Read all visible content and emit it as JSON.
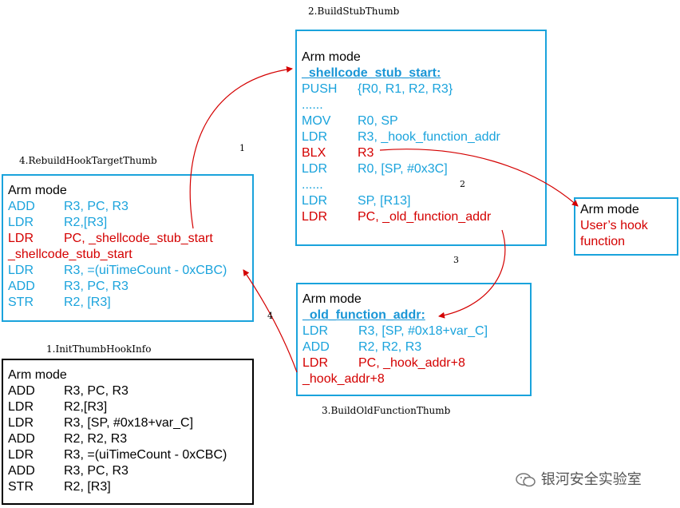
{
  "captions": {
    "build_stub": "2.BuildStubThumb",
    "rebuild_hook": "4.RebuildHookTargetThumb",
    "init_hook": "1.InitThumbHookInfo",
    "build_old": "3.BuildOldFunctionThumb"
  },
  "arrow_labels": [
    "1",
    "2",
    "3",
    "4"
  ],
  "stub_box": {
    "mode": "Arm mode",
    "label": "_shellcode_stub_start:",
    "lines": [
      {
        "op": "PUSH",
        "arg": "{R0, R1, R2, R3}",
        "color": "blue"
      },
      {
        "op": "......",
        "arg": "",
        "color": "blue"
      },
      {
        "op": "MOV",
        "arg": "R0, SP",
        "color": "blue"
      },
      {
        "op": "LDR",
        "arg": "R3, _hook_function_addr",
        "color": "blue"
      },
      {
        "op": "BLX",
        "arg": "R3",
        "color": "red"
      },
      {
        "op": "LDR",
        "arg": "R0, [SP, #0x3C]",
        "color": "blue"
      },
      {
        "op": "......",
        "arg": "",
        "color": "blue"
      },
      {
        "op": "LDR",
        "arg": "SP, [R13]",
        "color": "blue"
      },
      {
        "op": "LDR",
        "arg": "PC, _old_function_addr",
        "color": "red"
      }
    ]
  },
  "rebuild_box": {
    "mode": "Arm mode",
    "lines": [
      {
        "op": "ADD",
        "arg": "R3, PC, R3",
        "color": "blue"
      },
      {
        "op": "LDR",
        "arg": "R2,[R3]",
        "color": "blue"
      },
      {
        "op": "LDR",
        "arg": "PC, _shellcode_stub_start",
        "color": "red"
      },
      {
        "op": "_shellcode_stub_start",
        "arg": "",
        "color": "red",
        "full": true
      },
      {
        "op": "LDR",
        "arg": "R3, =(uiTimeCount - 0xCBC)",
        "color": "blue"
      },
      {
        "op": "ADD",
        "arg": "R3, PC, R3",
        "color": "blue"
      },
      {
        "op": "STR",
        "arg": "R2, [R3]",
        "color": "blue"
      }
    ]
  },
  "hook_box": {
    "mode": "Arm mode",
    "lines": [
      "User’s hook",
      "function"
    ]
  },
  "old_box": {
    "mode": "Arm mode",
    "label": "_old_function_addr:",
    "lines": [
      {
        "op": "LDR",
        "arg": "R3, [SP, #0x18+var_C]",
        "color": "blue"
      },
      {
        "op": "ADD",
        "arg": "R2, R2, R3",
        "color": "blue"
      },
      {
        "op": "LDR",
        "arg": "PC, _hook_addr+8",
        "color": "red"
      },
      {
        "op": "_hook_addr+8",
        "arg": "",
        "color": "red",
        "full": true
      }
    ]
  },
  "init_box": {
    "mode": "Arm mode",
    "lines": [
      {
        "op": "ADD",
        "arg": "R3, PC, R3",
        "color": "black-t"
      },
      {
        "op": "LDR",
        "arg": "R2,[R3]",
        "color": "black-t"
      },
      {
        "op": "LDR",
        "arg": "R3, [SP, #0x18+var_C]",
        "color": "black-t"
      },
      {
        "op": "ADD",
        "arg": "R2, R2, R3",
        "color": "black-t"
      },
      {
        "op": "LDR",
        "arg": "R3, =(uiTimeCount - 0xCBC)",
        "color": "black-t"
      },
      {
        "op": "ADD",
        "arg": "R3, PC, R3",
        "color": "black-t"
      },
      {
        "op": "STR",
        "arg": "R2, [R3]",
        "color": "black-t"
      }
    ]
  },
  "watermark": "银河安全实验室",
  "colors": {
    "cyan": "#1aa3dc",
    "red": "#d40000",
    "black": "#000000"
  }
}
